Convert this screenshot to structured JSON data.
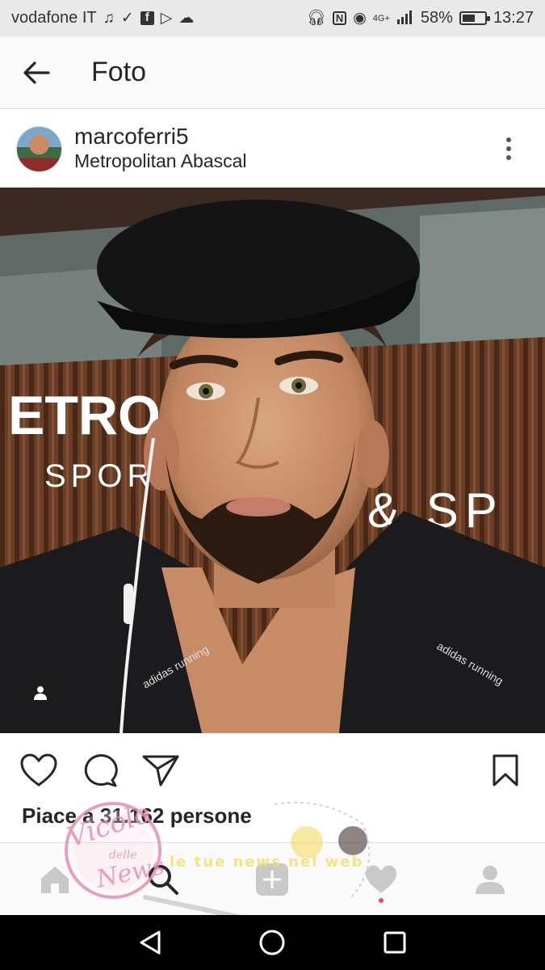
{
  "status_bar": {
    "carrier": "vodafone IT",
    "network": "4G+",
    "battery_text": "58%",
    "battery_level": 0.58,
    "time": "13:27",
    "left_icons": [
      "music-note-icon",
      "download-done-icon",
      "facebook-icon",
      "play-store-icon",
      "cloud-icon"
    ],
    "right_icons": [
      "headphones-icon",
      "nfc-icon",
      "eye-icon",
      "signal-icon",
      "battery-icon"
    ]
  },
  "app_bar": {
    "title": "Foto",
    "back_icon": "arrow-left-icon"
  },
  "post": {
    "username": "marcoferri5",
    "location": "Metropolitan Abascal",
    "photo_sign_line1": "ETRO LI",
    "photo_sign_line2": "SPORT",
    "photo_sign_line3": "& SP",
    "jacket_brand": "adidas running",
    "likes_text": "Piace a 31.162 persone"
  },
  "actions": {
    "icons": [
      "heart-icon",
      "comment-icon",
      "share-icon",
      "bookmark-icon"
    ]
  },
  "bottom_nav": {
    "items": [
      "home-icon",
      "search-icon",
      "add-icon",
      "activity-heart-icon",
      "profile-icon"
    ]
  },
  "watermark": {
    "text1": "Vicolo",
    "text2": "delle",
    "text3": "News",
    "text4": "le tue news nel web"
  },
  "colors": {
    "notification": "#ed4956",
    "text": "#262626",
    "statusbar_bg": "#e9e9e9"
  }
}
